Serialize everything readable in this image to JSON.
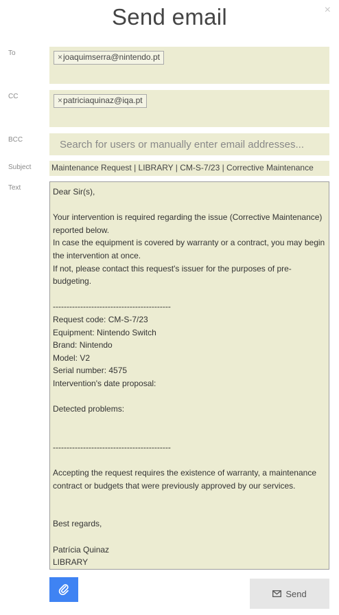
{
  "dialog": {
    "title": "Send email",
    "close_glyph": "×"
  },
  "labels": {
    "to": "To",
    "cc": "CC",
    "bcc": "BCC",
    "subject": "Subject",
    "text": "Text"
  },
  "to": {
    "chips": [
      {
        "remove_glyph": "×",
        "email": "joaquimserra@nintendo.pt"
      }
    ]
  },
  "cc": {
    "chips": [
      {
        "remove_glyph": "×",
        "email": "patriciaquinaz@iqa.pt"
      }
    ]
  },
  "bcc": {
    "placeholder": "Search for users or manually enter email addresses...",
    "value": ""
  },
  "subject": {
    "value": "Maintenance Request | LIBRARY | CM-S-7/23 | Corrective Maintenance"
  },
  "body": {
    "text": "Dear Sir(s),\n\nYour intervention is required regarding the issue (Corrective Maintenance) reported below.\nIn case the equipment is covered by warranty or a contract, you may begin the intervention at once.\nIf not, please contact this request's issuer for the purposes of pre-budgeting.\n\n-------------------------------------------\nRequest code: CM-S-7/23\nEquipment: Nintendo Switch\nBrand: Nintendo\nModel: V2\nSerial number: 4575\nIntervention's date proposal:\n\nDetected problems:\n\n\n-------------------------------------------\n\nAccepting the request requires the existence of warranty, a maintenance contract or budgets that were previously approved by our services.\n\n\nBest regards,\n\nPatrícia Quinaz\nLIBRARY"
  },
  "actions": {
    "attach_icon": "paperclip-icon",
    "send_icon": "envelope-icon",
    "send_label": "Send"
  },
  "colors": {
    "field_bg": "#ececd2",
    "attach_button": "#3f83f3",
    "send_button": "#e6e6e6"
  }
}
